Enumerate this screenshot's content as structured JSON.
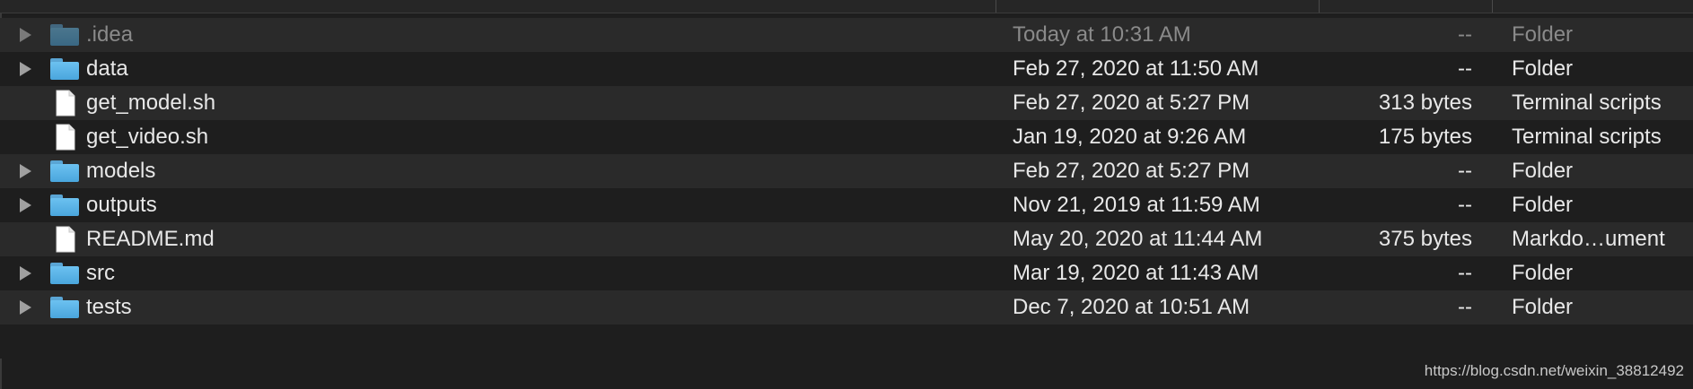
{
  "files": [
    {
      "name": ".idea",
      "date": "Today at 10:31 AM",
      "size": "--",
      "kind": "Folder",
      "type": "folder",
      "dim": true
    },
    {
      "name": "data",
      "date": "Feb 27, 2020 at 11:50 AM",
      "size": "--",
      "kind": "Folder",
      "type": "folder",
      "dim": false
    },
    {
      "name": "get_model.sh",
      "date": "Feb 27, 2020 at 5:27 PM",
      "size": "313 bytes",
      "kind": "Terminal scripts",
      "type": "file",
      "dim": false
    },
    {
      "name": "get_video.sh",
      "date": "Jan 19, 2020 at 9:26 AM",
      "size": "175 bytes",
      "kind": "Terminal scripts",
      "type": "file",
      "dim": false
    },
    {
      "name": "models",
      "date": "Feb 27, 2020 at 5:27 PM",
      "size": "--",
      "kind": "Folder",
      "type": "folder",
      "dim": false
    },
    {
      "name": "outputs",
      "date": "Nov 21, 2019 at 11:59 AM",
      "size": "--",
      "kind": "Folder",
      "type": "folder",
      "dim": false
    },
    {
      "name": "README.md",
      "date": "May 20, 2020 at 11:44 AM",
      "size": "375 bytes",
      "kind": "Markdo…ument",
      "type": "file",
      "dim": false
    },
    {
      "name": "src",
      "date": "Mar 19, 2020 at 11:43 AM",
      "size": "--",
      "kind": "Folder",
      "type": "folder",
      "dim": false
    },
    {
      "name": "tests",
      "date": "Dec 7, 2020 at 10:51 AM",
      "size": "--",
      "kind": "Folder",
      "type": "folder",
      "dim": false
    }
  ],
  "watermark": "https://blog.csdn.net/weixin_38812492",
  "colors": {
    "folder": "#5aaee3",
    "row_alt": "#2a2a2a",
    "background": "#1e1e1e",
    "text": "#e8e8e8",
    "dim_text": "#8a8a8a"
  },
  "icons": {
    "expand": "disclosure-triangle-icon",
    "folder": "folder-icon",
    "file": "document-icon"
  }
}
